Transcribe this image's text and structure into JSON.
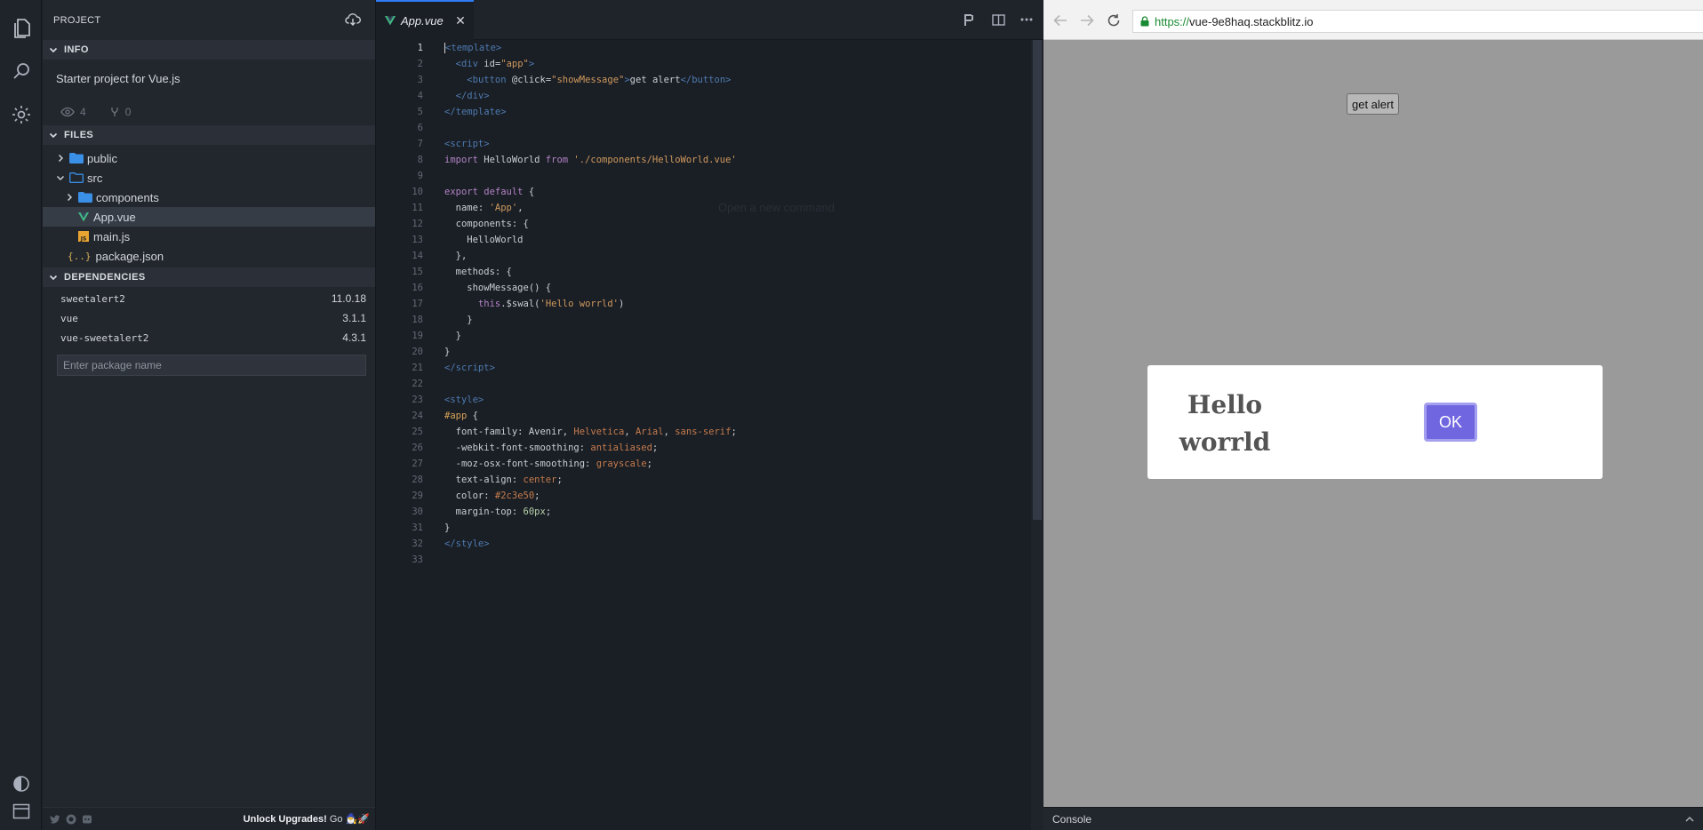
{
  "activity": {
    "icons": [
      "files-icon",
      "search-icon",
      "settings-gear-icon",
      "theme-toggle-icon",
      "layout-panel-icon"
    ]
  },
  "sidebar": {
    "title": "PROJECT",
    "info_header": "INFO",
    "description": "Starter project for Vue.js",
    "views": "4",
    "forks": "0",
    "files_header": "FILES",
    "files": [
      {
        "name": "public",
        "type": "folder",
        "expanded": false
      },
      {
        "name": "src",
        "type": "folder",
        "expanded": true
      },
      {
        "name": "components",
        "type": "folder",
        "expanded": false
      },
      {
        "name": "App.vue",
        "type": "vue-file",
        "selected": true
      },
      {
        "name": "main.js",
        "type": "js-file"
      },
      {
        "name": "package.json",
        "type": "json-file"
      }
    ],
    "deps_header": "DEPENDENCIES",
    "dependencies": [
      {
        "name": "sweetalert2",
        "version": "11.0.18"
      },
      {
        "name": "vue",
        "version": "3.1.1"
      },
      {
        "name": "vue-sweetalert2",
        "version": "4.3.1"
      }
    ],
    "package_placeholder": "Enter package name",
    "footer_bold": "Unlock Upgrades!",
    "footer_go": "Go 🧙‍♂️🚀"
  },
  "editor": {
    "tab_label": "App.vue",
    "tab_close": "✕",
    "ghost_hint": "Open a new command",
    "line_count": 33
  },
  "preview": {
    "url_proto": "https://",
    "url_host": "vue-9e8haq.stackblitz.io",
    "app_button": "get alert",
    "alert_title": "Hello worrld",
    "alert_ok": "OK",
    "console_label": "Console"
  },
  "colors": {
    "accent": "#2e7cf6",
    "swal_confirm": "#7066e0",
    "url_secure": "#1a8a32"
  }
}
